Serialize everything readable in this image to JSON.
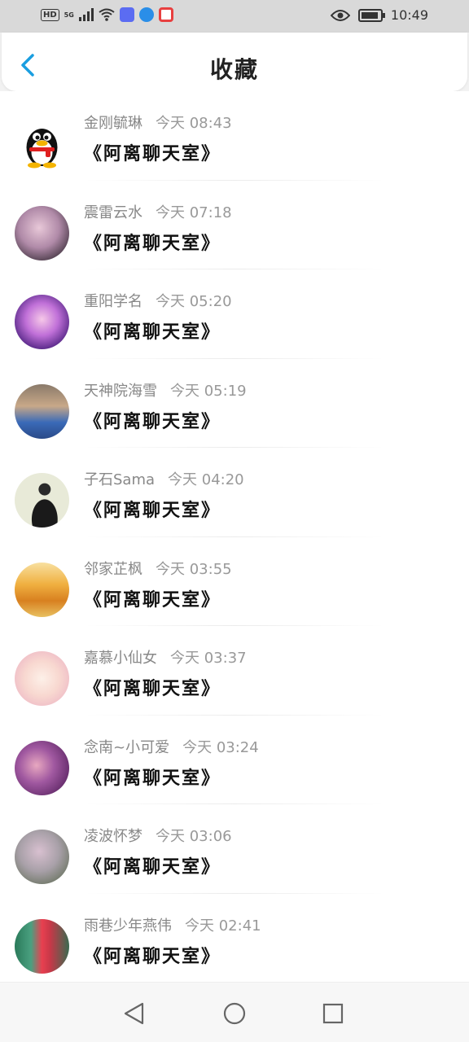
{
  "status_bar": {
    "network_label": "HD",
    "network_type": "5G",
    "time": "10:49"
  },
  "header": {
    "title": "收藏",
    "back_icon": "chevron-left-icon"
  },
  "favorites": [
    {
      "name": "金刚毓琳",
      "time": "今天 08:43",
      "room": "《阿离聊天室》",
      "avatar": "qq-penguin"
    },
    {
      "name": "震雷云水",
      "time": "今天 07:18",
      "room": "《阿离聊天室》",
      "avatar": "anime-girl"
    },
    {
      "name": "重阳学名",
      "time": "今天 05:20",
      "room": "《阿离聊天室》",
      "avatar": "anime-purple"
    },
    {
      "name": "天神院海雪",
      "time": "今天 05:19",
      "room": "《阿离聊天室》",
      "avatar": "boy-photo"
    },
    {
      "name": "子石Sama",
      "time": "今天 04:20",
      "room": "《阿离聊天室》",
      "avatar": "man-black-shirt"
    },
    {
      "name": "邻家芷枫",
      "time": "今天 03:55",
      "room": "《阿离聊天室》",
      "avatar": "autumn-trees"
    },
    {
      "name": "嘉慕小仙女",
      "time": "今天 03:37",
      "room": "《阿离聊天室》",
      "avatar": "cute-girl"
    },
    {
      "name": "念南~小可爱",
      "time": "今天 03:24",
      "room": "《阿离聊天室》",
      "avatar": "couple-purple"
    },
    {
      "name": "凌波怀梦",
      "time": "今天 03:06",
      "room": "《阿离聊天室》",
      "avatar": "woman-field"
    },
    {
      "name": "雨巷少年燕伟",
      "time": "今天 02:41",
      "room": "《阿离聊天室》",
      "avatar": "woman-red-dress"
    }
  ],
  "nav": {
    "back": "triangle-back-icon",
    "home": "circle-home-icon",
    "recents": "square-recents-icon"
  },
  "colors": {
    "accent": "#1a9ee0",
    "status_bar_bg": "#d9d9d9"
  }
}
